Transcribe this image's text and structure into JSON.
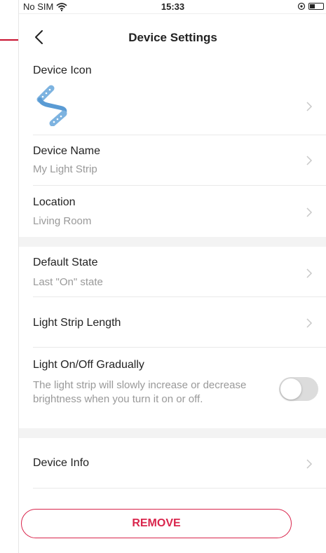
{
  "status_bar": {
    "carrier": "No SIM",
    "time": "15:33"
  },
  "nav": {
    "title": "Device Settings"
  },
  "device_icon": {
    "label": "Device Icon",
    "icon": "light-strip-icon"
  },
  "device_name": {
    "label": "Device Name",
    "value": "My Light Strip"
  },
  "location": {
    "label": "Location",
    "value": "Living Room"
  },
  "default_state": {
    "label": "Default State",
    "value": "Last \"On\" state"
  },
  "light_strip_length": {
    "label": "Light Strip Length"
  },
  "gradual": {
    "label": "Light On/Off Gradually",
    "description": "The light strip will slowly increase or decrease brightness when you turn it on or off.",
    "enabled": false
  },
  "device_info": {
    "label": "Device Info"
  },
  "remove_label": "REMOVE",
  "colors": {
    "accent": "#d9254c",
    "strip_icon": "#7db3e0",
    "annotation_arrow": "#c8102e"
  }
}
